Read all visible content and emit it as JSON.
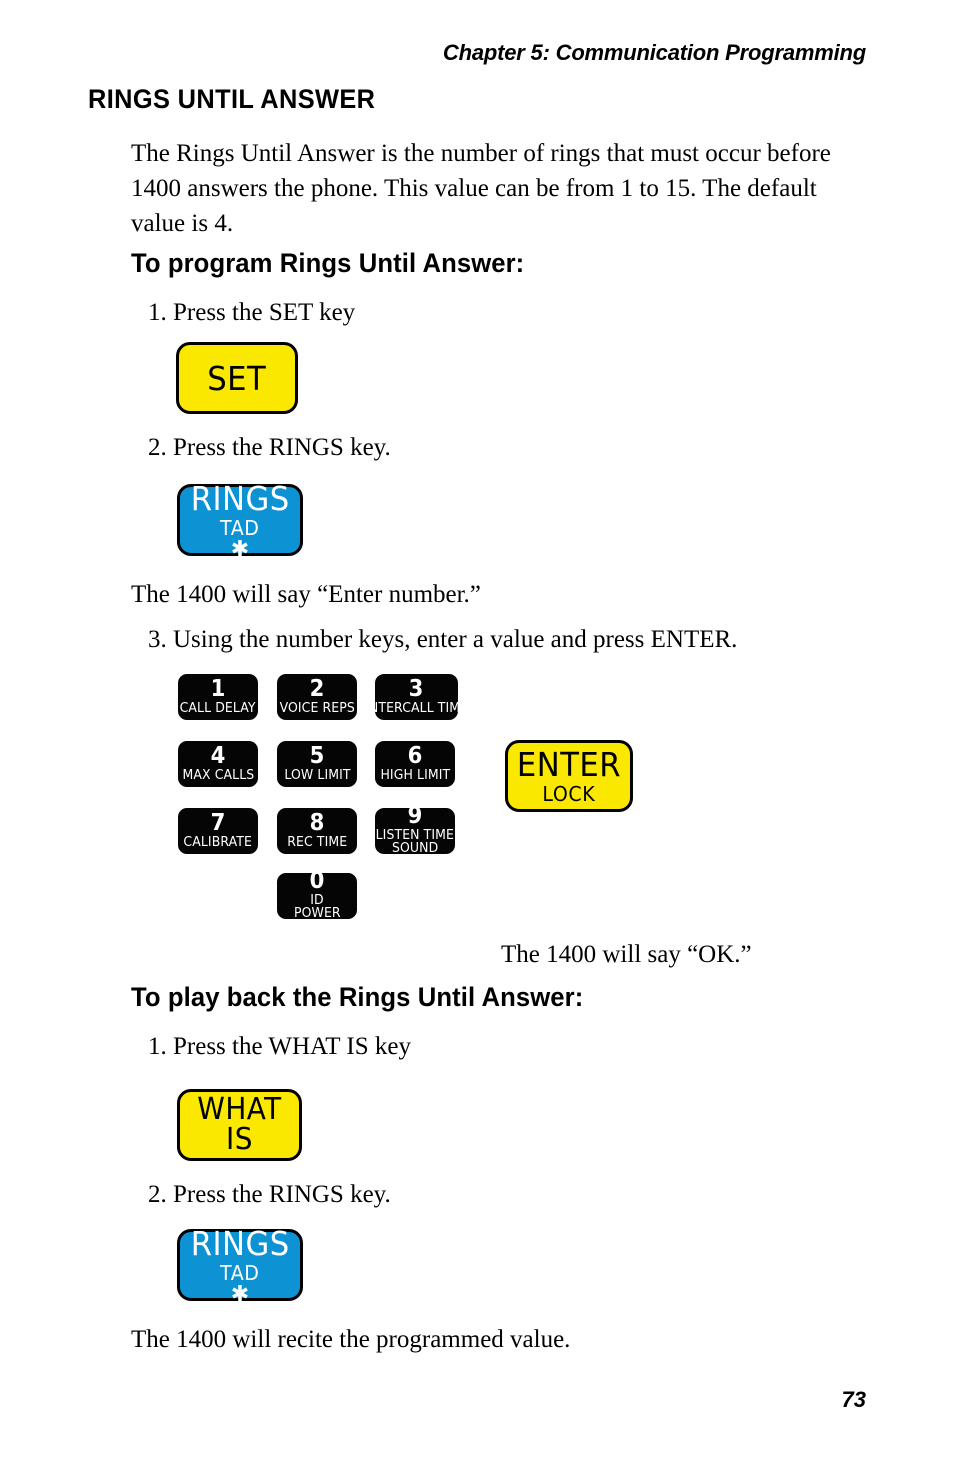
{
  "header": {
    "running_head": "Chapter 5: Communication Programming"
  },
  "section": {
    "title": "RINGS UNTIL ANSWER",
    "intro": "The Rings Until Answer is the number of rings that must occur before 1400 answers the phone. This value can be from 1 to 15. The default value is 4."
  },
  "program": {
    "heading": "To program Rings Until Answer:",
    "step1": "1. Press the SET key",
    "step2": "2. Press the RINGS key.",
    "say_enter_number": "The 1400 will say “Enter number.”",
    "step3": "3. Using the number keys, enter a value and press ENTER.",
    "say_ok": "The 1400 will say “OK.”"
  },
  "playback": {
    "heading": "To play back the Rings Until Answer:",
    "step1": "1. Press the WHAT IS key",
    "step2": "2. Press the RINGS key.",
    "result": "The 1400 will recite the programmed value."
  },
  "keys": {
    "set": {
      "main": "SET"
    },
    "rings": {
      "main": "RINGS",
      "sub": "TAD",
      "star": "✱"
    },
    "whatis": {
      "main": "WHAT IS"
    },
    "enter": {
      "main": "ENTER",
      "sub": "LOCK"
    },
    "numeric": [
      {
        "digit": "1",
        "labels": [
          "CALL DELAY"
        ]
      },
      {
        "digit": "2",
        "labels": [
          "VOICE REPS"
        ]
      },
      {
        "digit": "3",
        "labels": [
          "INTERCALL TIME"
        ]
      },
      {
        "digit": "4",
        "labels": [
          "MAX CALLS"
        ]
      },
      {
        "digit": "5",
        "labels": [
          "LOW LIMIT"
        ]
      },
      {
        "digit": "6",
        "labels": [
          "HIGH LIMIT"
        ]
      },
      {
        "digit": "7",
        "labels": [
          "CALIBRATE"
        ]
      },
      {
        "digit": "8",
        "labels": [
          "REC TIME"
        ]
      },
      {
        "digit": "9",
        "labels": [
          "LISTEN TIME",
          "SOUND"
        ]
      },
      {
        "digit": "0",
        "labels": [
          "ID",
          "POWER"
        ]
      }
    ]
  },
  "footer": {
    "page_number": "73"
  },
  "colors": {
    "yellow_key": "#fbe800",
    "blue_key": "#0d92d4",
    "black_key": "#050505",
    "text": "#000000"
  }
}
